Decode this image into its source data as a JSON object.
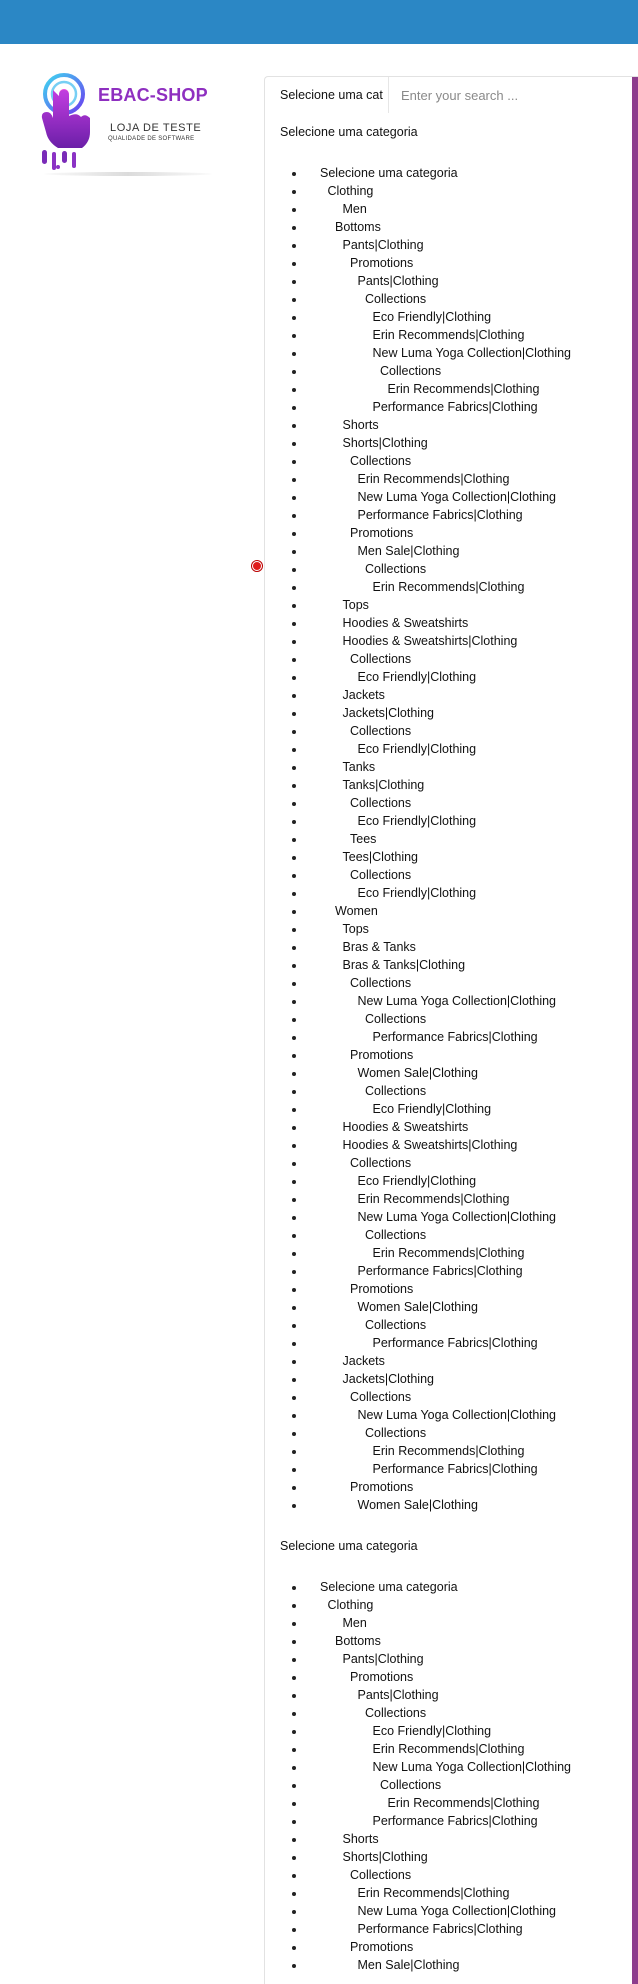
{
  "logo": {
    "brand": "EBAC-SHOP",
    "line1": "LOJA DE TESTE",
    "line2": "QUALIDADE DE SOFTWARE"
  },
  "search": {
    "category_label": "Selecione uma cat",
    "placeholder": "Enter your search ..."
  },
  "headings": [
    "Selecione uma categoria",
    "Selecione uma categoria"
  ],
  "tree1": [
    {
      "label": "Selecione uma categoria",
      "level": 0
    },
    {
      "label": "Clothing",
      "level": 1
    },
    {
      "label": "Men",
      "level": 3
    },
    {
      "label": "Bottoms",
      "level": 2
    },
    {
      "label": "Pants|Clothing",
      "level": 3
    },
    {
      "label": "Promotions",
      "level": 4
    },
    {
      "label": "Pants|Clothing",
      "level": 5
    },
    {
      "label": "Collections",
      "level": 6
    },
    {
      "label": "Eco Friendly|Clothing",
      "level": 7
    },
    {
      "label": "Erin Recommends|Clothing",
      "level": 7
    },
    {
      "label": "New Luma Yoga Collection|Clothing",
      "level": 7
    },
    {
      "label": "Collections",
      "level": 8
    },
    {
      "label": "Erin Recommends|Clothing",
      "level": 9
    },
    {
      "label": "Performance Fabrics|Clothing",
      "level": 7
    },
    {
      "label": "Shorts",
      "level": 3
    },
    {
      "label": "Shorts|Clothing",
      "level": 3
    },
    {
      "label": "Collections",
      "level": 4
    },
    {
      "label": "Erin Recommends|Clothing",
      "level": 5
    },
    {
      "label": "New Luma Yoga Collection|Clothing",
      "level": 5
    },
    {
      "label": "Performance Fabrics|Clothing",
      "level": 5
    },
    {
      "label": "Promotions",
      "level": 4
    },
    {
      "label": "Men Sale|Clothing",
      "level": 5
    },
    {
      "label": "Collections",
      "level": 6
    },
    {
      "label": "Erin Recommends|Clothing",
      "level": 7
    },
    {
      "label": "Tops",
      "level": 3
    },
    {
      "label": "Hoodies & Sweatshirts",
      "level": 3
    },
    {
      "label": "Hoodies & Sweatshirts|Clothing",
      "level": 3
    },
    {
      "label": "Collections",
      "level": 4
    },
    {
      "label": "Eco Friendly|Clothing",
      "level": 5
    },
    {
      "label": "Jackets",
      "level": 3
    },
    {
      "label": "Jackets|Clothing",
      "level": 3
    },
    {
      "label": "Collections",
      "level": 4
    },
    {
      "label": "Eco Friendly|Clothing",
      "level": 5
    },
    {
      "label": "Tanks",
      "level": 3
    },
    {
      "label": "Tanks|Clothing",
      "level": 3
    },
    {
      "label": "Collections",
      "level": 4
    },
    {
      "label": "Eco Friendly|Clothing",
      "level": 5
    },
    {
      "label": "Tees",
      "level": 4
    },
    {
      "label": "Tees|Clothing",
      "level": 3
    },
    {
      "label": "Collections",
      "level": 4
    },
    {
      "label": "Eco Friendly|Clothing",
      "level": 5
    },
    {
      "label": "Women",
      "level": 2
    },
    {
      "label": "Tops",
      "level": 3
    },
    {
      "label": "Bras & Tanks",
      "level": 3
    },
    {
      "label": "Bras & Tanks|Clothing",
      "level": 3
    },
    {
      "label": "Collections",
      "level": 4
    },
    {
      "label": "New Luma Yoga Collection|Clothing",
      "level": 5
    },
    {
      "label": "Collections",
      "level": 6
    },
    {
      "label": "Performance Fabrics|Clothing",
      "level": 7
    },
    {
      "label": "Promotions",
      "level": 4
    },
    {
      "label": "Women Sale|Clothing",
      "level": 5
    },
    {
      "label": "Collections",
      "level": 6
    },
    {
      "label": "Eco Friendly|Clothing",
      "level": 7
    },
    {
      "label": "Hoodies & Sweatshirts",
      "level": 3
    },
    {
      "label": "Hoodies & Sweatshirts|Clothing",
      "level": 3
    },
    {
      "label": "Collections",
      "level": 4
    },
    {
      "label": "Eco Friendly|Clothing",
      "level": 5
    },
    {
      "label": "Erin Recommends|Clothing",
      "level": 5
    },
    {
      "label": "New Luma Yoga Collection|Clothing",
      "level": 5
    },
    {
      "label": "Collections",
      "level": 6
    },
    {
      "label": "Erin Recommends|Clothing",
      "level": 7
    },
    {
      "label": "Performance Fabrics|Clothing",
      "level": 5
    },
    {
      "label": "Promotions",
      "level": 4
    },
    {
      "label": "Women Sale|Clothing",
      "level": 5
    },
    {
      "label": "Collections",
      "level": 6
    },
    {
      "label": "Performance Fabrics|Clothing",
      "level": 7
    },
    {
      "label": "Jackets",
      "level": 3
    },
    {
      "label": "Jackets|Clothing",
      "level": 3
    },
    {
      "label": "Collections",
      "level": 4
    },
    {
      "label": "New Luma Yoga Collection|Clothing",
      "level": 5
    },
    {
      "label": "Collections",
      "level": 6
    },
    {
      "label": "Erin Recommends|Clothing",
      "level": 7
    },
    {
      "label": "Performance Fabrics|Clothing",
      "level": 7
    },
    {
      "label": "Promotions",
      "level": 4
    },
    {
      "label": "Women Sale|Clothing",
      "level": 5
    }
  ],
  "tree2": [
    {
      "label": "Selecione uma categoria",
      "level": 0
    },
    {
      "label": "Clothing",
      "level": 1
    },
    {
      "label": "Men",
      "level": 3
    },
    {
      "label": "Bottoms",
      "level": 2
    },
    {
      "label": "Pants|Clothing",
      "level": 3
    },
    {
      "label": "Promotions",
      "level": 4
    },
    {
      "label": "Pants|Clothing",
      "level": 5
    },
    {
      "label": "Collections",
      "level": 6
    },
    {
      "label": "Eco Friendly|Clothing",
      "level": 7
    },
    {
      "label": "Erin Recommends|Clothing",
      "level": 7
    },
    {
      "label": "New Luma Yoga Collection|Clothing",
      "level": 7
    },
    {
      "label": "Collections",
      "level": 8
    },
    {
      "label": "Erin Recommends|Clothing",
      "level": 9
    },
    {
      "label": "Performance Fabrics|Clothing",
      "level": 7
    },
    {
      "label": "Shorts",
      "level": 3
    },
    {
      "label": "Shorts|Clothing",
      "level": 3
    },
    {
      "label": "Collections",
      "level": 4
    },
    {
      "label": "Erin Recommends|Clothing",
      "level": 5
    },
    {
      "label": "New Luma Yoga Collection|Clothing",
      "level": 5
    },
    {
      "label": "Performance Fabrics|Clothing",
      "level": 5
    },
    {
      "label": "Promotions",
      "level": 4
    },
    {
      "label": "Men Sale|Clothing",
      "level": 5
    }
  ]
}
